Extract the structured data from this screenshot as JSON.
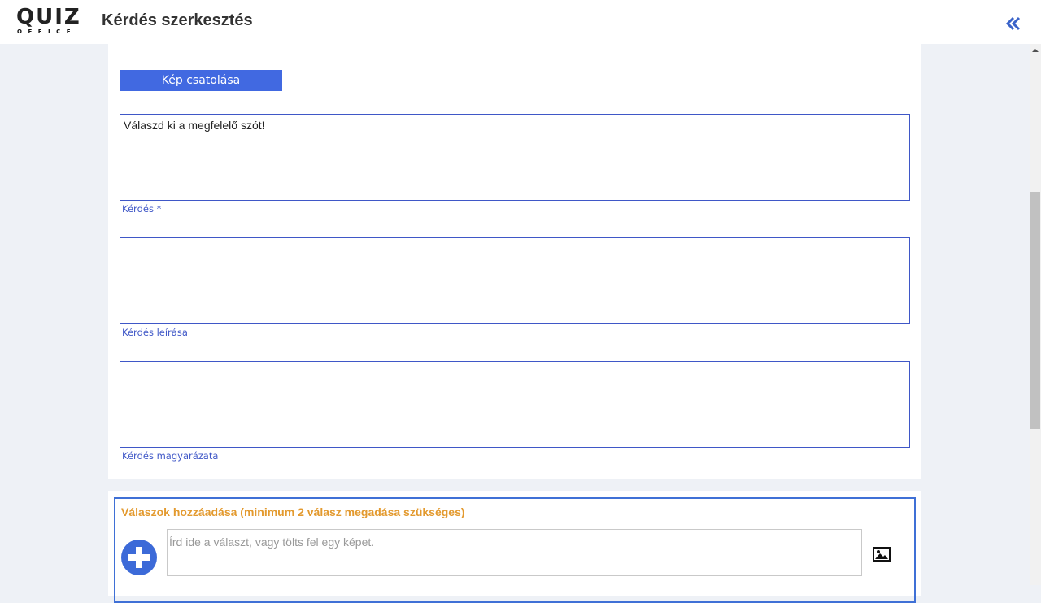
{
  "header": {
    "logo_main": "QUIZ",
    "logo_sub": "OFFICE",
    "title": "Kérdés szerkesztés",
    "collapse_icon": "double-chevron-left-icon"
  },
  "form": {
    "attach_image_label": "Kép csatolása",
    "question_value": "Válaszd ki a megfelelő szót!",
    "question_label": "Kérdés *",
    "description_value": "",
    "description_label": "Kérdés leírása",
    "explanation_value": "",
    "explanation_label": "Kérdés magyarázata"
  },
  "answers": {
    "title": "Válaszok hozzáadása (minimum 2 válasz megadása szükséges)",
    "input_placeholder": "Írd ide a választ, vagy tölts fel egy képet.",
    "add_icon": "plus-circle-icon",
    "image_icon": "image-icon"
  },
  "colors": {
    "accent": "#4169e1",
    "field_border": "#3f57c7",
    "answers_title": "#e39a2f",
    "background": "#eef1f6"
  }
}
